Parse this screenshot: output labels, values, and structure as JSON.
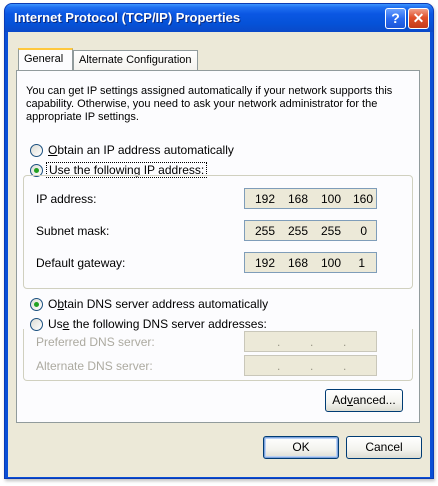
{
  "window": {
    "title": "Internet Protocol (TCP/IP) Properties",
    "help_icon": "?",
    "close_icon": "✕"
  },
  "tabs": [
    {
      "label": "General",
      "selected": true
    },
    {
      "label": "Alternate Configuration",
      "selected": false
    }
  ],
  "intro_text": "You can get IP settings assigned automatically if your network supports this capability. Otherwise, you need to ask your network administrator for the appropriate IP settings.",
  "ip_mode": {
    "auto": {
      "label_prefix": "",
      "mnemonic": "O",
      "label_rest": "btain an IP address automatically",
      "checked": false
    },
    "manual": {
      "label_prefix": "U",
      "mnemonic": "s",
      "label_rest": "e the following IP address:",
      "checked": true
    }
  },
  "ip_fields": [
    {
      "label": "IP address:",
      "octets": [
        "192",
        "168",
        "100",
        "160"
      ],
      "enabled": true
    },
    {
      "label": "Subnet mask:",
      "octets": [
        "255",
        "255",
        "255",
        "0"
      ],
      "enabled": true
    },
    {
      "label": "Default gateway:",
      "octets": [
        "192",
        "168",
        "100",
        "1"
      ],
      "enabled": true
    }
  ],
  "dns_mode": {
    "auto": {
      "label_prefix": "O",
      "mnemonic": "b",
      "label_rest": "tain DNS server address automatically",
      "checked": true
    },
    "manual": {
      "label_prefix": "Us",
      "mnemonic": "e",
      "label_rest": " the following DNS server addresses:",
      "checked": false
    }
  },
  "dns_fields": [
    {
      "label": "Preferred DNS server:",
      "enabled": false
    },
    {
      "label": "Alternate DNS server:",
      "enabled": false
    }
  ],
  "buttons": {
    "advanced": {
      "prefix": "Ad",
      "mnemonic": "v",
      "rest": "anced..."
    },
    "ok": "OK",
    "cancel": "Cancel"
  },
  "colors": {
    "titlebar": "#0552d8",
    "dialog_bg": "#ece9d8",
    "radio_dot": "#21a121",
    "active_tab_accent": "#ffc83c"
  }
}
